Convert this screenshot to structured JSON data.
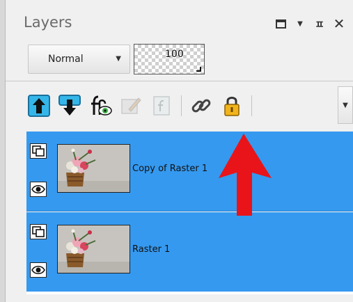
{
  "panel": {
    "title": "Layers",
    "window_controls": [
      "maximize-icon",
      "menu-arrow-icon",
      "pin-icon",
      "close-icon"
    ]
  },
  "blend": {
    "mode": "Normal",
    "opacity": "100"
  },
  "toolbar": {
    "tools": [
      {
        "name": "move-layer-up-icon",
        "enabled": true
      },
      {
        "name": "move-layer-down-icon",
        "enabled": true
      },
      {
        "name": "layer-effects-icon",
        "enabled": true
      },
      {
        "name": "edit-selection-icon",
        "enabled": false
      },
      {
        "name": "fx-icon",
        "enabled": false
      },
      {
        "name": "link-icon",
        "enabled": true
      },
      {
        "name": "lock-icon",
        "enabled": true
      }
    ]
  },
  "layers": [
    {
      "name": "Copy of Raster 1",
      "visible": true,
      "selected": true
    },
    {
      "name": "Raster 1",
      "visible": true,
      "selected": true
    }
  ],
  "colors": {
    "selected_row": "#3599ef",
    "annotation_arrow": "#e8141a"
  }
}
